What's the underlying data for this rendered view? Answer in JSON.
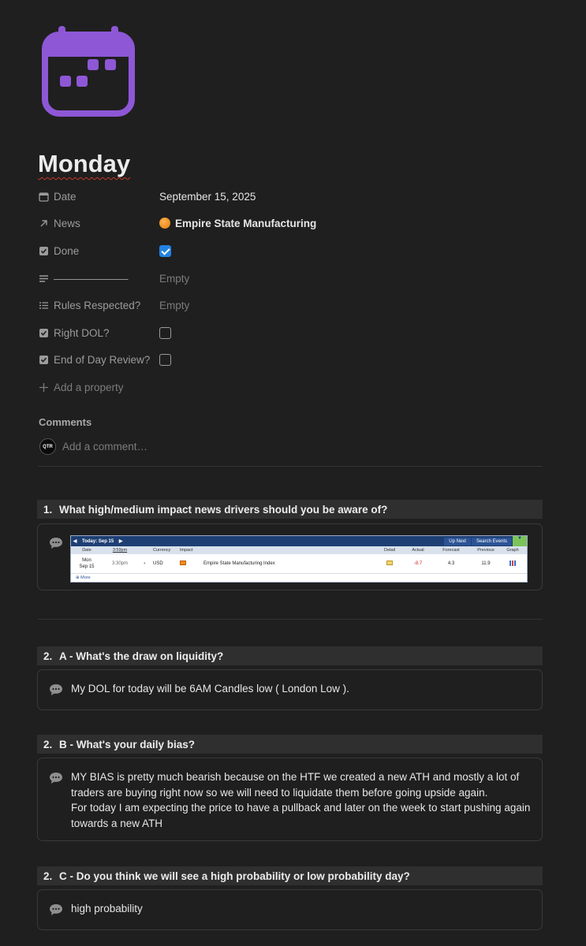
{
  "page": {
    "icon": "calendar-icon",
    "title": "Monday",
    "accent_color": "#9b5fe0"
  },
  "properties": [
    {
      "icon": "calendar-icon",
      "label": "Date",
      "value": "September 15, 2025"
    },
    {
      "icon": "arrow-up-right-icon",
      "label": "News",
      "value": "Empire State Manufacturing"
    },
    {
      "icon": "checkbox-icon",
      "label": "Done",
      "checked": true
    },
    {
      "icon": "text-lines-icon",
      "label": "———————",
      "value": "Empty"
    },
    {
      "icon": "list-icon",
      "label": "Rules Respected?",
      "value": "Empty"
    },
    {
      "icon": "checkbox-icon",
      "label": "Right DOL?",
      "checked": false
    },
    {
      "icon": "checkbox-icon",
      "label": "End of Day Review?",
      "checked": false
    }
  ],
  "add_property_label": "Add a property",
  "comments": {
    "heading": "Comments",
    "avatar_text": "QTR",
    "placeholder": "Add a comment…"
  },
  "sections": [
    {
      "num": "1.",
      "question": "What high/medium impact news drivers should you be aware of?",
      "calendar": {
        "today_label": "Today: Sep 15",
        "buttons": [
          "Up Next",
          "Search Events"
        ],
        "headers": [
          "Date",
          "3:59pm",
          "Currency",
          "Impact",
          "",
          "Detail",
          "Actual",
          "Forecast",
          "Previous",
          "Graph"
        ],
        "row": {
          "day": "Mon",
          "date": "Sep 15",
          "time": "3:30pm",
          "currency": "USD",
          "event": "Empire State Manufacturing Index",
          "actual": "-8.7",
          "forecast": "4.3",
          "previous": "11.9"
        },
        "more": "More"
      }
    },
    {
      "num": "2.",
      "question": "A - What's the draw on liquidity?",
      "answer": "My DOL for today will be 6AM Candles low ( London Low )."
    },
    {
      "num": "2.",
      "question": "B - What's your daily bias?",
      "answer_lines": [
        "MY BIAS is pretty much bearish because on the HTF we created a new ATH and mostly a lot of",
        "traders are buying right now so we will need to liquidate them before going upside again.",
        "For today I am expecting the price to have a pullback and later on the week to start pushing again",
        "towards a new ATH"
      ]
    },
    {
      "num": "2.",
      "question": "C - Do you think we will see a high probability or low probability day?",
      "answer": "high probability"
    }
  ]
}
